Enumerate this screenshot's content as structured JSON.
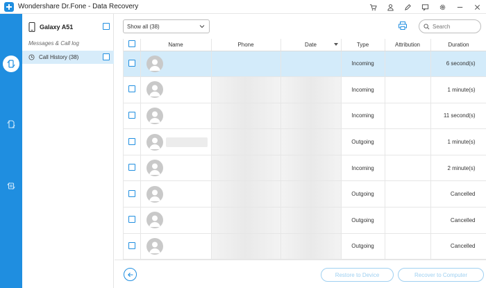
{
  "app": {
    "title": "Wondershare Dr.Fone - Data Recovery"
  },
  "title_icons": [
    "cart-icon",
    "user-icon",
    "pencil-icon",
    "chat-icon",
    "settings-icon",
    "minimize-icon",
    "close-icon"
  ],
  "rail": {
    "items": [
      "recover-device-icon",
      "recover-sd-icon",
      "recover-backup-icon"
    ]
  },
  "sidebar": {
    "device_name": "Galaxy A51",
    "group_label": "Messages & Call log",
    "category_label": "Call History (38)"
  },
  "toolbar": {
    "filter_value": "Show all (38)",
    "search_placeholder": "Search"
  },
  "table": {
    "headers": {
      "name": "Name",
      "phone": "Phone",
      "date": "Date",
      "type": "Type",
      "attribution": "Attribution",
      "duration": "Duration"
    },
    "rows": [
      {
        "type": "Incoming",
        "duration": "6 second(s)",
        "selected": true
      },
      {
        "type": "Incoming",
        "duration": "1 minute(s)"
      },
      {
        "type": "Incoming",
        "duration": "11 second(s)"
      },
      {
        "type": "Outgoing",
        "duration": "1 minute(s)"
      },
      {
        "type": "Incoming",
        "duration": "2 minute(s)"
      },
      {
        "type": "Outgoing",
        "duration": "Cancelled"
      },
      {
        "type": "Outgoing",
        "duration": "Cancelled"
      },
      {
        "type": "Outgoing",
        "duration": "Cancelled"
      }
    ]
  },
  "bottom": {
    "restore_label": "Restore to Device",
    "recover_label": "Recover to Computer"
  },
  "colors": {
    "accent": "#1f8ee0",
    "selected_row": "#d3ebfa",
    "disabled_button": "#9fd0f1"
  }
}
